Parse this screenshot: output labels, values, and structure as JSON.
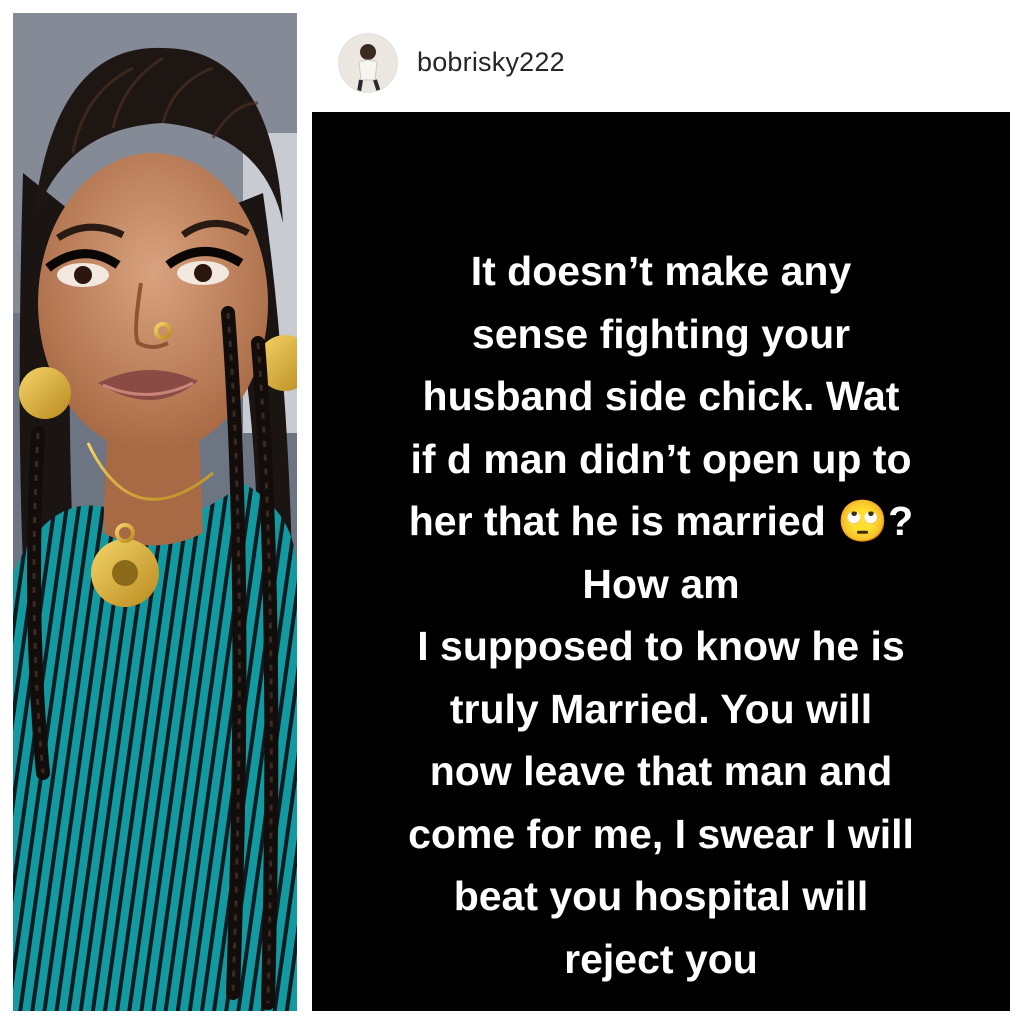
{
  "post": {
    "username": "bobrisky222",
    "story_text": "It doesn’t make any\nsense fighting your\nhusband side chick. Wat\nif d man didn’t open up to\nher that he is married 🙄?\nHow am\nI supposed to know he is\ntruly Married. You will\nnow leave that man and\ncome for me, I swear I will\nbeat you hospital will\nreject you"
  },
  "icons": {
    "avatar": "profile-avatar-icon"
  },
  "colors": {
    "story_background": "#000000",
    "story_text": "#ffffff",
    "header_background": "#ffffff",
    "username_text": "#262626",
    "dress_teal": "#139aa0",
    "dress_stripe": "#0d1b22"
  }
}
